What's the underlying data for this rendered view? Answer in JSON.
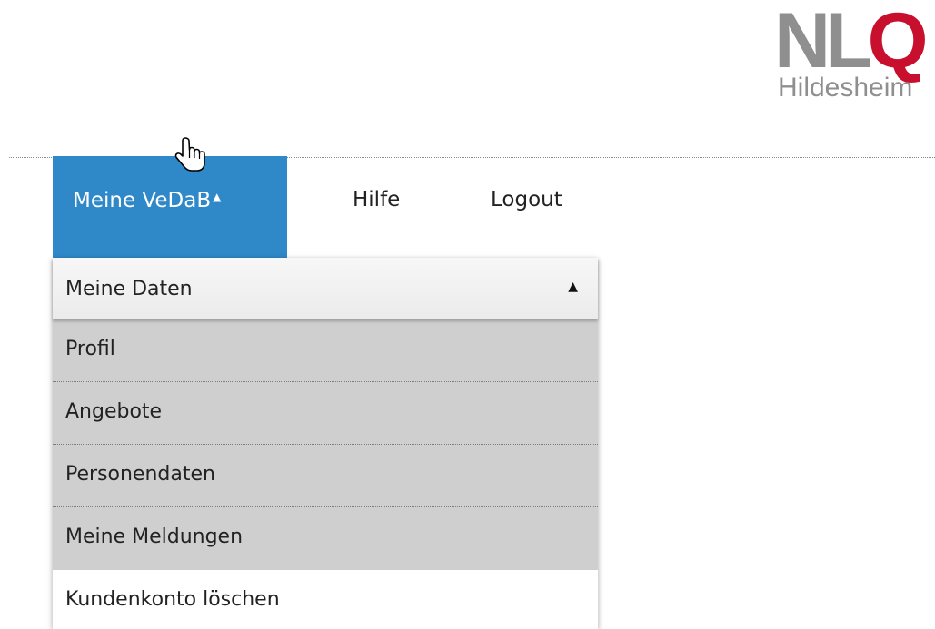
{
  "logo": {
    "nl": "NL",
    "q": "Q",
    "sub": "Hildesheim"
  },
  "nav": {
    "active_label": "Meine VeDaB",
    "active_caret": "▲",
    "links": [
      "Hilfe",
      "Logout"
    ]
  },
  "dropdown": {
    "header_label": "Meine Daten",
    "header_caret": "▲",
    "items": [
      "Profil",
      "Angebote",
      "Personendaten",
      "Meine Meldungen"
    ],
    "footer_item": "Kundenkonto löschen"
  },
  "colors": {
    "nav_active_bg": "#2f88c8",
    "logo_gray": "#8f8f8f",
    "logo_red": "#c8102e",
    "submenu_bg": "#cfcfcf"
  }
}
